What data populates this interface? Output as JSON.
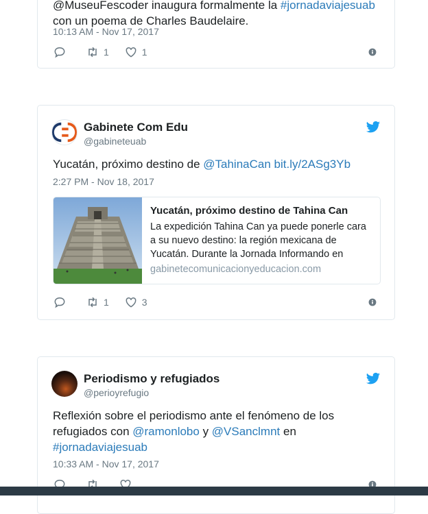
{
  "tweets": [
    {
      "text_prefix": "@MuseuFescoder inaugura formalmente la ",
      "hashtag": "#jornadaviajesuab",
      "text_line2": "con un poema de Charles Baudelaire.",
      "timestamp": "10:13 AM - Nov 17, 2017",
      "retweets": "1",
      "likes": "1"
    },
    {
      "name": "Gabinete Com Edu",
      "handle": "@gabineteuab",
      "text": "Yucatán, próximo destino de ",
      "mention": "@TahinaCan",
      "url": "bit.ly/2ASg3Yb",
      "timestamp": "2:27 PM - Nov 18, 2017",
      "card": {
        "title": "Yucatán, próximo destino de Tahina Can",
        "description": "La expedición Tahina Can ya puede ponerle cara a su nuevo destino: la región mexicana de Yucatán. Durante la Jornada Informando en",
        "domain": "gabinetecomunicacionyeducacion.com"
      },
      "retweets": "1",
      "likes": "3"
    },
    {
      "name": "Periodismo y refugiados",
      "handle": "@perioyrefugio",
      "text1": "Reflexión sobre el periodismo ante el fenómeno de los refugiados con ",
      "mention1": "@ramonlobo",
      "text2": " y ",
      "mention2": "@VSanclmnt",
      "text3": " en",
      "hashtag": "#jornadaviajesuab",
      "timestamp": "10:33 AM - Nov 17, 2017"
    }
  ],
  "colors": {
    "link": "#2b7bb9",
    "twitter_blue": "#1da1f2",
    "meta": "#697882"
  }
}
